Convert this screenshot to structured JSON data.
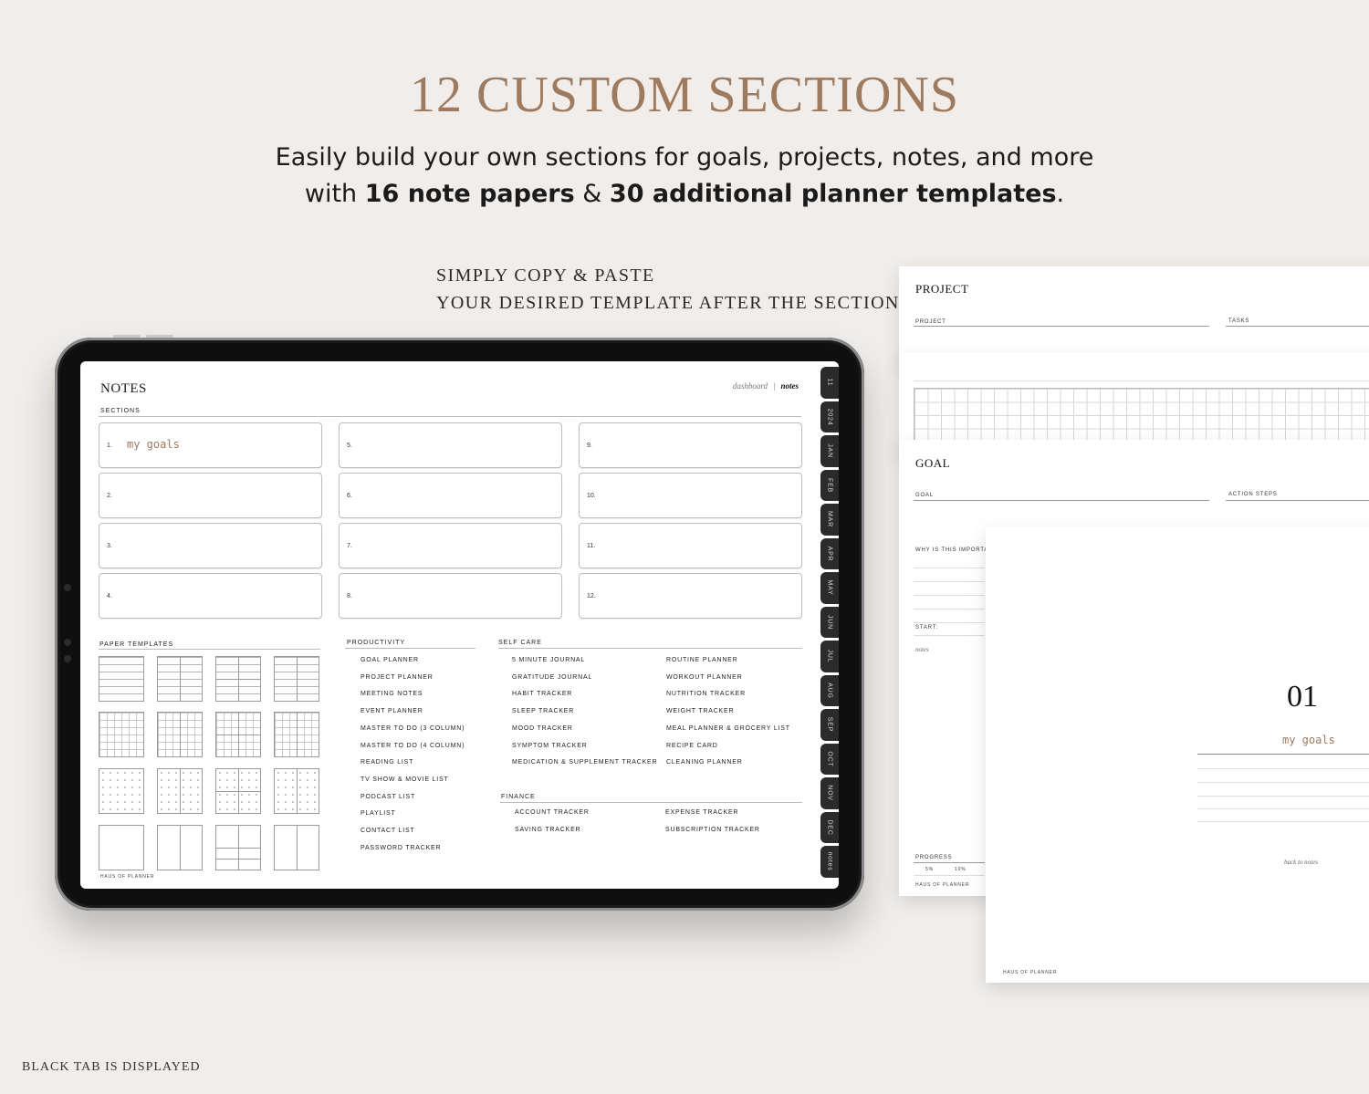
{
  "hero": {
    "title": "12 CUSTOM SECTIONS",
    "sub_line1": "Easily build your own sections for goals, projects, notes, and more",
    "sub_line2_a": "with ",
    "sub_line2_b": "16 note papers",
    "sub_line2_c": " & ",
    "sub_line2_d": "30 additional planner templates",
    "sub_line2_e": "."
  },
  "instructions": {
    "line1": "SIMPLY COPY & PASTE",
    "line2": "YOUR DESIRED TEMPLATE AFTER THE SECTION."
  },
  "footnote": "BLACK TAB IS DISPLAYED",
  "colors": {
    "accent": "#9e7a5f",
    "background": "#f1edea",
    "tab": "#2b2b2b"
  },
  "tablet": {
    "title": "NOTES",
    "nav": {
      "dashboard": "dashboard",
      "separator": "|",
      "notes": "notes"
    },
    "sections_label": "SECTIONS",
    "sections": [
      {
        "num": "1.",
        "text": "my goals"
      },
      {
        "num": "2.",
        "text": ""
      },
      {
        "num": "3.",
        "text": ""
      },
      {
        "num": "4.",
        "text": ""
      },
      {
        "num": "5.",
        "text": ""
      },
      {
        "num": "6.",
        "text": ""
      },
      {
        "num": "7.",
        "text": ""
      },
      {
        "num": "8.",
        "text": ""
      },
      {
        "num": "9.",
        "text": ""
      },
      {
        "num": "10.",
        "text": ""
      },
      {
        "num": "11.",
        "text": ""
      },
      {
        "num": "12.",
        "text": ""
      }
    ],
    "paper_templates_label": "PAPER TEMPLATES",
    "productivity_label": "PRODUCTIVITY",
    "productivity": [
      "GOAL PLANNER",
      "PROJECT PLANNER",
      "MEETING NOTES",
      "EVENT PLANNER",
      "MASTER TO DO (3 COLUMN)",
      "MASTER TO DO (4 COLUMN)",
      "READING LIST",
      "TV SHOW & MOVIE LIST",
      "PODCAST LIST",
      "PLAYLIST",
      "CONTACT LIST",
      "PASSWORD TRACKER"
    ],
    "selfcare_label": "SELF CARE",
    "selfcare_col1": [
      "5 MINUTE JOURNAL",
      "GRATITUDE JOURNAL",
      "HABIT TRACKER",
      "SLEEP TRACKER",
      "MOOD TRACKER",
      "SYMPTOM TRACKER",
      "MEDICATION & SUPPLEMENT TRACKER"
    ],
    "selfcare_col2": [
      "ROUTINE PLANNER",
      "WORKOUT PLANNER",
      "NUTRITION TRACKER",
      "WEIGHT TRACKER",
      "MEAL PLANNER & GROCERY LIST",
      "RECIPE CARD",
      "CLEANING PLANNER"
    ],
    "finance_label": "FINANCE",
    "finance_col1": [
      "ACCOUNT TRACKER",
      "SAVING TRACKER"
    ],
    "finance_col2": [
      "EXPENSE TRACKER",
      "SUBSCRIPTION TRACKER"
    ],
    "brand": "HAUS OF PLANNER",
    "tabs": [
      "11",
      "2024",
      "JAN",
      "FEB",
      "MAR",
      "APR",
      "MAY",
      "JUN",
      "JUL",
      "AUG",
      "SEP",
      "OCT",
      "NOV",
      "DEC",
      "notes"
    ]
  },
  "pages": {
    "project": {
      "title": "PROJECT",
      "project_label": "PROJECT",
      "tasks_label": "TASKS"
    },
    "goal": {
      "title": "GOAL",
      "goal_label": "GOAL",
      "action_label": "ACTION STEPS",
      "why_label": "WHY IS THIS IMPORTANT",
      "start_label": "START:",
      "notes_label": "notes",
      "progress_label": "PROGRESS",
      "p1": "5%",
      "p2": "10%",
      "brand": "HAUS OF PLANNER"
    },
    "section": {
      "number": "01",
      "name": "my goals",
      "back": "back to notes",
      "brand": "HAUS OF PLANNER"
    }
  }
}
